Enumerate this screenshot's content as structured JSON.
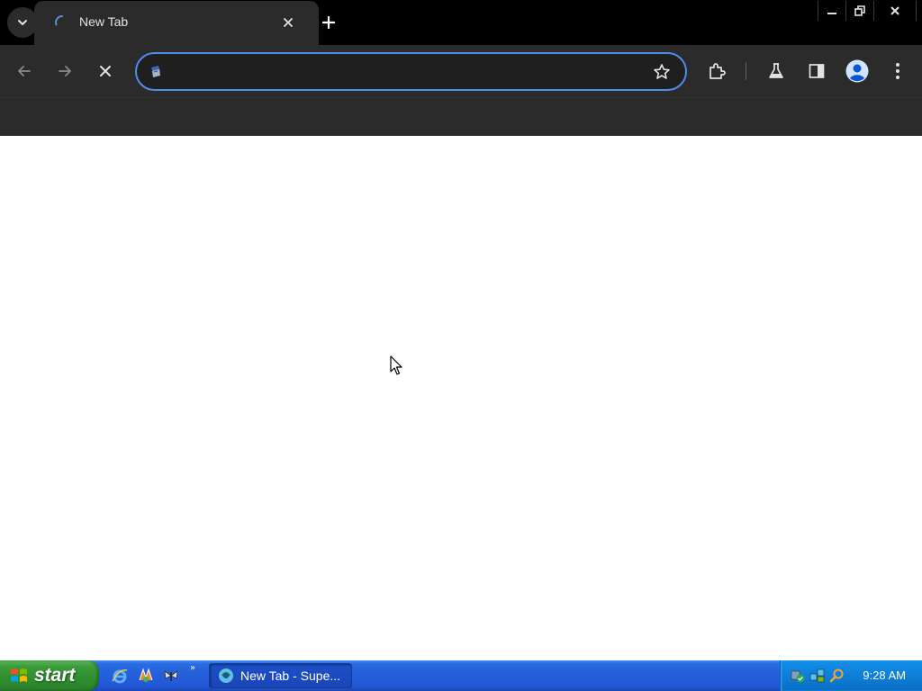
{
  "browser": {
    "tabs": [
      {
        "title": "New Tab",
        "loading": true
      }
    ],
    "omnibox": {
      "value": "",
      "placeholder": ""
    }
  },
  "taskbar": {
    "start_label": "start",
    "quick_launch_more": "»",
    "task_buttons": [
      {
        "label": "New Tab - Supe..."
      }
    ],
    "clock": "9:28 AM"
  },
  "colors": {
    "tab_strip": "#000000",
    "toolbar": "#2b2b2b",
    "omnibox_focus_ring": "#4d8ee8",
    "taskbar_blue": "#245edb",
    "start_green": "#3c9c3c",
    "tray_blue": "#0f7fd8"
  },
  "icons": {
    "tab_search": "chevron-down-icon",
    "tab_loading": "loading-spinner-icon",
    "tab_close": "close-icon",
    "new_tab": "plus-icon",
    "back": "arrow-left-icon",
    "forward": "arrow-right-icon",
    "stop": "close-icon",
    "site_info": "site-info-icon",
    "bookmark": "star-icon",
    "extensions": "puzzle-icon",
    "labs": "flask-icon",
    "side_panel": "side-panel-icon",
    "profile": "avatar-icon",
    "menu": "kebab-menu-icon"
  }
}
